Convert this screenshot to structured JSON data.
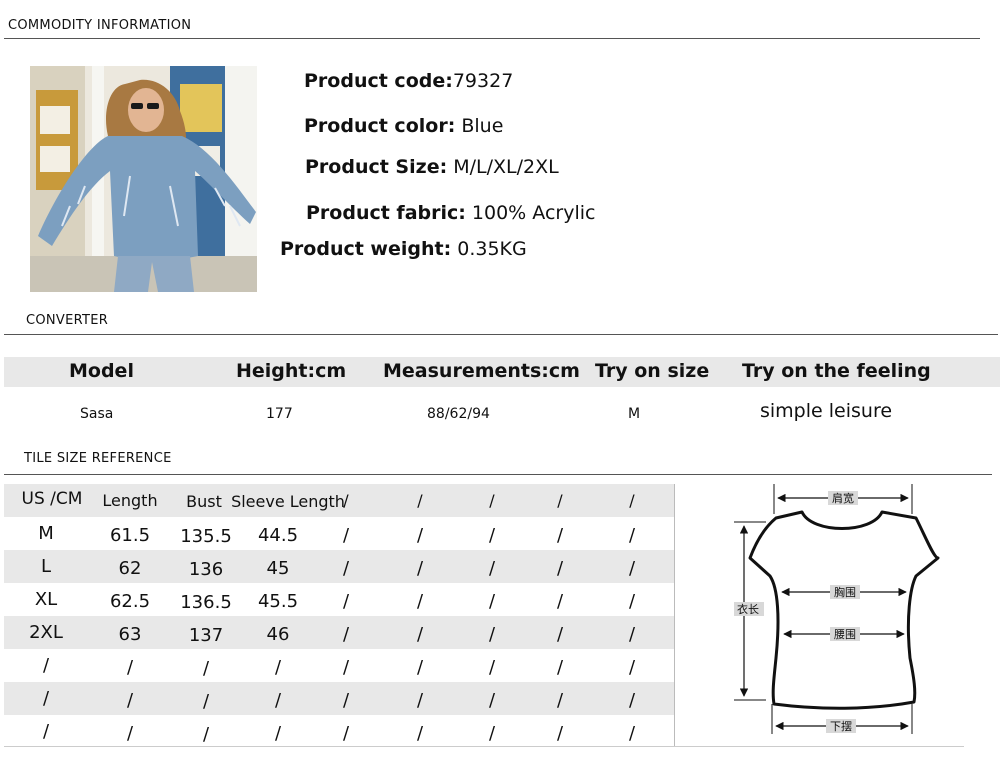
{
  "sections": {
    "commodity": "COMMODITY INFORMATION",
    "converter": "CONVERTER",
    "tile": "TILE SIZE REFERENCE"
  },
  "product": {
    "code_label": "Product code:",
    "code_value": "79327",
    "color_label": "Product color:",
    "color_value": "Blue",
    "size_label": "Product Size:",
    "size_value": "M/L/XL/2XL",
    "fabric_label": "Product fabric:",
    "fabric_value": "100% Acrylic",
    "weight_label": "Product weight:",
    "weight_value": "0.35KG"
  },
  "converter": {
    "headers": [
      "Model",
      "Height:cm",
      "Measurements:cm",
      "Try on size",
      "Try on the feeling"
    ],
    "values": [
      "Sasa",
      "177",
      "88/62/94",
      "M",
      "simple leisure"
    ]
  },
  "size_table": {
    "headers": [
      "US /CM",
      "Length",
      "Bust",
      "Sleeve Length",
      "/",
      "/",
      "/",
      "/",
      "/"
    ],
    "rows": [
      [
        "M",
        "61.5",
        "135.5",
        "44.5",
        "/",
        "/",
        "/",
        "/",
        "/"
      ],
      [
        "L",
        "62",
        "136",
        "45",
        "/",
        "/",
        "/",
        "/",
        "/"
      ],
      [
        "XL",
        "62.5",
        "136.5",
        "45.5",
        "/",
        "/",
        "/",
        "/",
        "/"
      ],
      [
        "2XL",
        "63",
        "137",
        "46",
        "/",
        "/",
        "/",
        "/",
        "/"
      ],
      [
        "/",
        "/",
        "/",
        "/",
        "/",
        "/",
        "/",
        "/",
        "/"
      ],
      [
        "/",
        "/",
        "/",
        "/",
        "/",
        "/",
        "/",
        "/",
        "/"
      ],
      [
        "/",
        "/",
        "/",
        "/",
        "/",
        "/",
        "/",
        "/",
        "/"
      ]
    ]
  },
  "diagram": {
    "shoulder": "肩宽",
    "chest": "胸围",
    "waist": "腰围",
    "length": "衣长",
    "hem": "下摆"
  },
  "colors": {
    "row_shade": "#e8e8e8",
    "sweater": "#7c9fc0",
    "rule": "#555555"
  }
}
